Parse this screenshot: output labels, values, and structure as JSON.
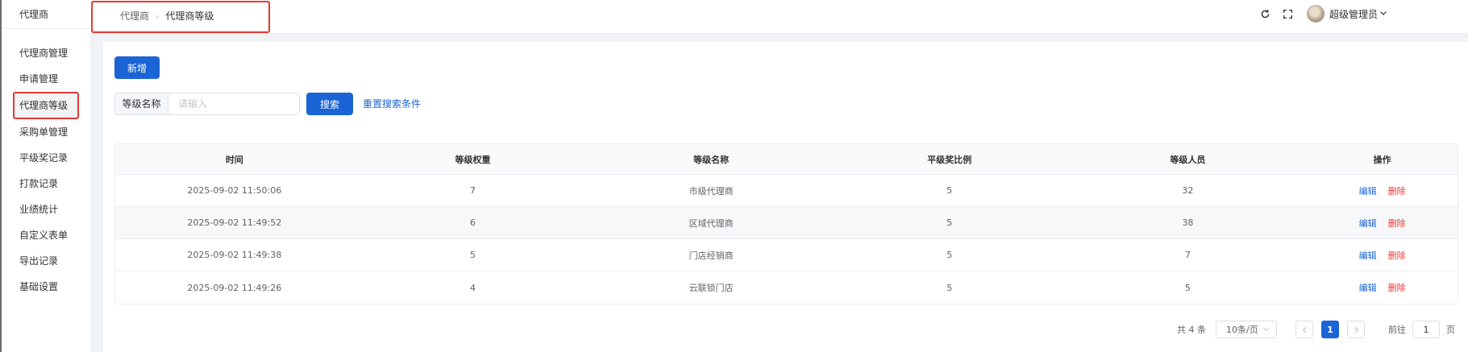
{
  "brand": "代理商",
  "sidebar": {
    "items": [
      {
        "label": "代理商管理"
      },
      {
        "label": "申请管理"
      },
      {
        "label": "代理商等级"
      },
      {
        "label": "采购单管理"
      },
      {
        "label": "平级奖记录"
      },
      {
        "label": "打款记录"
      },
      {
        "label": "业绩统计"
      },
      {
        "label": "自定义表单"
      },
      {
        "label": "导出记录"
      },
      {
        "label": "基础设置"
      }
    ],
    "active_index": 2
  },
  "breadcrumb": {
    "items": [
      "代理商",
      "代理商等级"
    ],
    "separator": "›"
  },
  "header": {
    "icons": [
      "refresh-icon",
      "fullscreen-icon"
    ],
    "username": "超级管理员"
  },
  "toolbar": {
    "add_label": "新增",
    "search_label": "等级名称",
    "search_placeholder": "请输入",
    "search_button": "搜索",
    "reset_link": "重置搜索条件"
  },
  "table": {
    "columns": [
      "时间",
      "等级权重",
      "等级名称",
      "平级奖比例",
      "等级人员",
      "操作"
    ],
    "rows": [
      {
        "time": "2025-09-02 11:50:06",
        "weight": "7",
        "name": "市级代理商",
        "ratio": "5",
        "members": "32"
      },
      {
        "time": "2025-09-02 11:49:52",
        "weight": "6",
        "name": "区域代理商",
        "ratio": "5",
        "members": "38"
      },
      {
        "time": "2025-09-02 11:49:38",
        "weight": "5",
        "name": "门店经销商",
        "ratio": "5",
        "members": "7"
      },
      {
        "time": "2025-09-02 11:49:26",
        "weight": "4",
        "name": "云联锁门店",
        "ratio": "5",
        "members": "5"
      }
    ],
    "edit_label": "编辑",
    "delete_label": "删除"
  },
  "pagination": {
    "total_text": "共 4 条",
    "page_size": "10条/页",
    "current_page": "1",
    "goto_label": "前往",
    "goto_value": "1",
    "page_suffix": "页"
  },
  "colors": {
    "primary": "#1a64d6",
    "danger": "#e53935"
  }
}
